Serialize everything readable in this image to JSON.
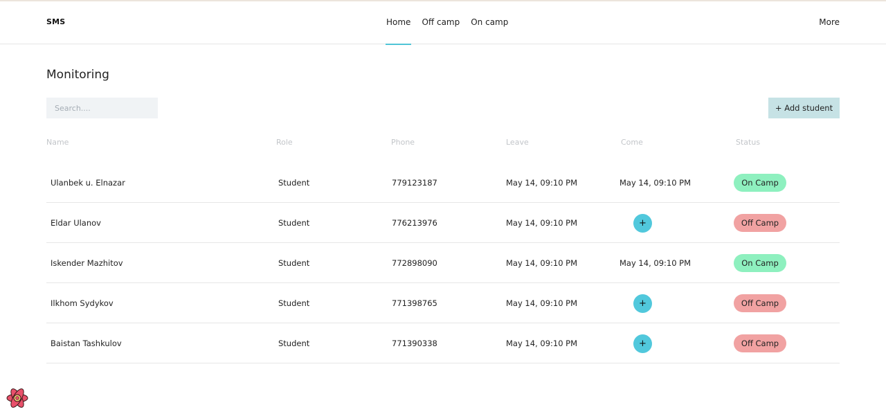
{
  "app": {
    "brand": "SMS"
  },
  "nav": {
    "items": [
      {
        "label": "Home",
        "active": true
      },
      {
        "label": "Off camp",
        "active": false
      },
      {
        "label": "On camp",
        "active": false
      }
    ],
    "more": "More"
  },
  "page": {
    "title": "Monitoring",
    "search_placeholder": "Search....",
    "add_button": "+ Add student"
  },
  "table": {
    "columns": [
      "Name",
      "Role",
      "Phone",
      "Leave",
      "Come",
      "Status"
    ],
    "rows": [
      {
        "name": "Ulanbek u. Elnazar",
        "role": "Student",
        "phone": "779123187",
        "leave": "May 14, 09:10 PM",
        "come": "May 14, 09:10 PM",
        "status": "On Camp"
      },
      {
        "name": "Eldar Ulanov",
        "role": "Student",
        "phone": "776213976",
        "leave": "May 14, 09:10 PM",
        "come": null,
        "come_button": "+",
        "status": "Off Camp"
      },
      {
        "name": "Iskender Mazhitov",
        "role": "Student",
        "phone": "772898090",
        "leave": "May 14, 09:10 PM",
        "come": "May 14, 09:10 PM",
        "status": "On Camp"
      },
      {
        "name": "Ilkhom Sydykov",
        "role": "Student",
        "phone": "771398765",
        "leave": "May 14, 09:10 PM",
        "come": null,
        "come_button": "+",
        "status": "Off Camp"
      },
      {
        "name": "Baistan Tashkulov",
        "role": "Student",
        "phone": "771390338",
        "leave": "May 14, 09:10 PM",
        "come": null,
        "come_button": "+",
        "status": "Off Camp"
      }
    ]
  },
  "colors": {
    "accent": "#4fc4d6",
    "on_camp": "#8ef0bf",
    "off_camp": "#f1a2a2",
    "add_button_bg": "#c6e2e5",
    "plus_button_bg": "#51c8dc"
  },
  "icons": {
    "devtools": "react-icon"
  }
}
